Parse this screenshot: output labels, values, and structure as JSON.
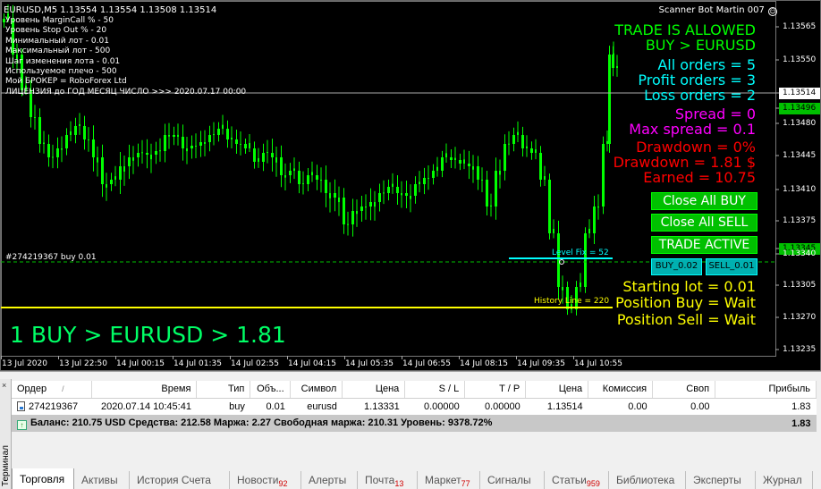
{
  "chart": {
    "ohlc_header": "EURUSD,M5  1.13554 1.13554 1.13508 1.13514",
    "ea_name": "Scanner Bot Martin 007",
    "info_lines": [
      "Уровень MarginCall % -  50",
      "Уровень Stop Out % -  20",
      "Минимальный лот -  0.01",
      "Максимальный лот -  500",
      "Шаг изменения лота -  0.01",
      "Используемое плечо -  500",
      "Мой БРОКЕР  =  RoboForex Ltd",
      "ЛИЦЕНЗИЯ до ГОД  МЕСЯЦ  ЧИСЛО >>> 2020.07.17 00:00"
    ],
    "panel": {
      "trade_allowed": "TRADE IS ALLOWED",
      "direction": "BUY > EURUSD",
      "all_orders": "All orders = 5",
      "profit_orders": "Profit orders = 3",
      "loss_orders": "Loss orders = 2",
      "spread": "Spread =  0",
      "max_spread": "Max spread =  0.1",
      "drawdown_pct": "Drawdown  = 0%",
      "drawdown_usd": "Drawdown = 1.81 $",
      "earned": "Earned = 10.75",
      "close_all_buy": "Close All BUY",
      "close_all_sell": "Close All SELL",
      "trade_active": "TRADE ACTIVE",
      "buy_btn": "BUY_0.02",
      "sell_btn": "SELL_0.01",
      "starting_lot": "Starting lot = 0.01",
      "position_buy": "Position Buy = Wait",
      "position_sell": "Position Sell = Wait"
    },
    "order_line_label": "#274219367 buy 0.01",
    "level_label": "Level Fix = 52",
    "history_label": "History Line = 220",
    "big_label": "1 BUY > EURUSD > 1.81",
    "price_axis": [
      "1.13565",
      "1.13550",
      "1.13514",
      "1.13496",
      "1.13480",
      "1.13445",
      "1.13410",
      "1.13375",
      "1.13345",
      "1.13340",
      "1.13305",
      "1.13270",
      "1.13235"
    ],
    "time_axis": [
      "13 Jul 2020",
      "13 Jul 22:50",
      "14 Jul 00:15",
      "14 Jul 01:35",
      "14 Jul 02:55",
      "14 Jul 04:15",
      "14 Jul 05:35",
      "14 Jul 06:55",
      "14 Jul 08:15",
      "14 Jul 09:35",
      "14 Jul 10:55"
    ],
    "colors": {
      "candles": "#00ff00",
      "panel_green": "#00ff00",
      "panel_cyan": "#00ffff",
      "panel_magenta": "#ff00ff",
      "panel_red": "#ff0000",
      "panel_yellow": "#ffff00",
      "bid_tag": "#ffffff",
      "ask_tag": "#00c000"
    }
  },
  "terminal": {
    "side_label": "Терминал",
    "close_glyph": "×",
    "columns": {
      "order": "Ордер",
      "sort": "/",
      "time": "Время",
      "type": "Тип",
      "volume": "Объ...",
      "symbol": "Символ",
      "price": "Цена",
      "sl": "S / L",
      "tp": "T / P",
      "price2": "Цена",
      "commission": "Комиссия",
      "swap": "Своп",
      "profit": "Прибыль"
    },
    "order_row": {
      "order": "274219367",
      "time": "2020.07.14 10:45:41",
      "type": "buy",
      "volume": "0.01",
      "symbol": "eurusd",
      "price": "1.13331",
      "sl": "0.00000",
      "tp": "0.00000",
      "price2": "1.13514",
      "commission": "0.00",
      "swap": "0.00",
      "profit": "1.83"
    },
    "balance_row": {
      "text": "Баланс: 210.75 USD  Средства: 212.58  Маржа: 2.27  Свободная маржа: 210.31  Уровень: 9378.72%",
      "profit": "1.83"
    },
    "tabs": [
      {
        "label": "Торговля",
        "badge": ""
      },
      {
        "label": "Активы",
        "badge": ""
      },
      {
        "label": "История Счета",
        "badge": ""
      },
      {
        "label": "Новости",
        "badge": "92"
      },
      {
        "label": "Алерты",
        "badge": ""
      },
      {
        "label": "Почта",
        "badge": "13"
      },
      {
        "label": "Маркет",
        "badge": "77"
      },
      {
        "label": "Сигналы",
        "badge": ""
      },
      {
        "label": "Статьи",
        "badge": "959"
      },
      {
        "label": "Библиотека",
        "badge": ""
      },
      {
        "label": "Эксперты",
        "badge": ""
      },
      {
        "label": "Журнал",
        "badge": ""
      }
    ]
  }
}
